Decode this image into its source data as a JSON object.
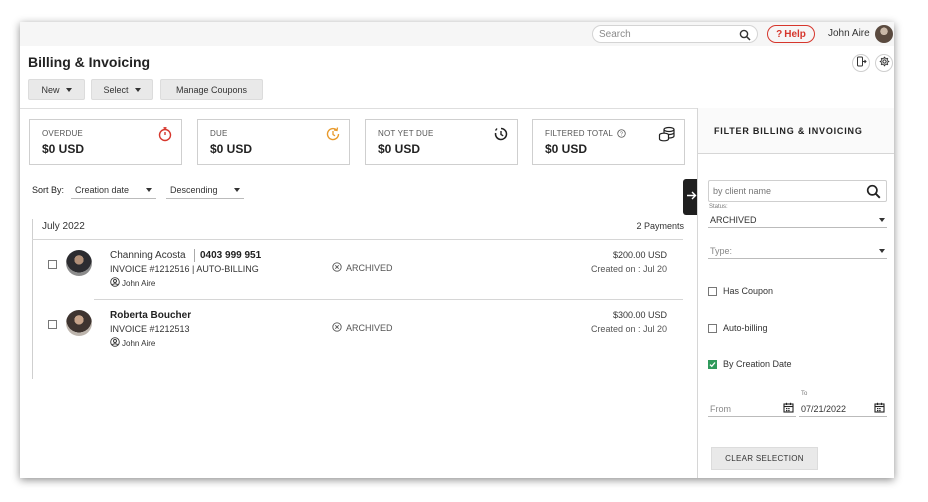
{
  "header": {
    "search_placeholder": "Search",
    "help_label": "Help",
    "help_glyph": "?",
    "user_name": "John Aire"
  },
  "page": {
    "title": "Billing & Invoicing"
  },
  "toolbar": {
    "new_label": "New",
    "select_label": "Select",
    "manage_coupons_label": "Manage Coupons"
  },
  "summary_cards": [
    {
      "title": "OVERDUE",
      "value": "$0 USD",
      "icon": "stopwatch-icon",
      "icon_color": "#d6362c"
    },
    {
      "title": "DUE",
      "value": "$0 USD",
      "icon": "clock-refresh-icon",
      "icon_color": "#e89a2c"
    },
    {
      "title": "NOT YET DUE",
      "value": "$0 USD",
      "icon": "clock-pending-icon",
      "icon_color": "#222222"
    },
    {
      "title": "FILTERED TOTAL",
      "value": "$0 USD",
      "icon": "coins-stack-icon",
      "icon_color": "#222222"
    }
  ],
  "sort": {
    "label": "Sort By:",
    "field": "Creation date",
    "order": "Descending"
  },
  "list": {
    "month": "July 2022",
    "payment_count": "2 Payments",
    "rows": [
      {
        "client": "Channing Acosta",
        "phone": "0403 999 951",
        "invoice": "INVOICE #1212516 | AUTO-BILLING",
        "owner": "John Aire",
        "status": "ARCHIVED",
        "amount": "$200.00 USD",
        "created": "Created on : Jul 20"
      },
      {
        "client": "Roberta Boucher",
        "phone": "",
        "invoice": "INVOICE #1212513",
        "owner": "John Aire",
        "status": "ARCHIVED",
        "amount": "$300.00 USD",
        "created": "Created on : Jul 20"
      }
    ]
  },
  "filter_panel": {
    "title": "FILTER BILLING & INVOICING",
    "client_placeholder": "by client name",
    "status_label": "Status:",
    "status_value": "ARCHIVED",
    "type_placeholder": "Type:",
    "has_coupon_label": "Has Coupon",
    "has_coupon_checked": false,
    "auto_billing_label": "Auto-billing",
    "auto_billing_checked": false,
    "by_creation_date_label": "By Creation Date",
    "by_creation_date_checked": true,
    "from_placeholder": "From",
    "to_label": "To",
    "to_value": "07/21/2022",
    "clear_label": "CLEAR SELECTION"
  },
  "colors": {
    "accent_red": "#d6362c",
    "accent_orange": "#e89a2c",
    "check_green": "#2f9a5b"
  }
}
